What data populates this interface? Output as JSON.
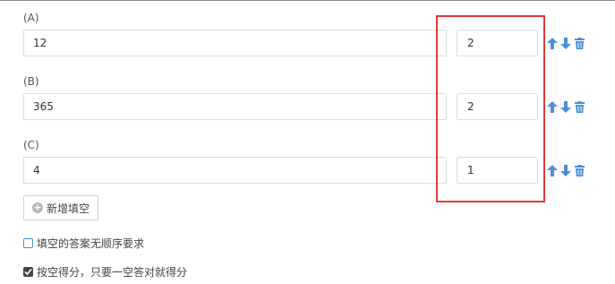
{
  "blanks": [
    {
      "label": "(A)",
      "answer": "12",
      "score": "2"
    },
    {
      "label": "(B)",
      "answer": "365",
      "score": "2"
    },
    {
      "label": "(C)",
      "answer": "4",
      "score": "1"
    }
  ],
  "add_button": {
    "label": "新增填空",
    "icon": "plus-circle-icon"
  },
  "options": [
    {
      "label": "填空的答案无顺序要求",
      "checked": false
    },
    {
      "label": "按空得分，只要一空答对就得分",
      "checked": true
    }
  ],
  "row_actions": {
    "icons": [
      "arrow-up-icon",
      "arrow-down-icon",
      "trash-icon"
    ]
  },
  "colors": {
    "accent": "#4a90d9",
    "highlight": "#e03a3a",
    "border": "#dcdcdc",
    "text": "#333333"
  }
}
